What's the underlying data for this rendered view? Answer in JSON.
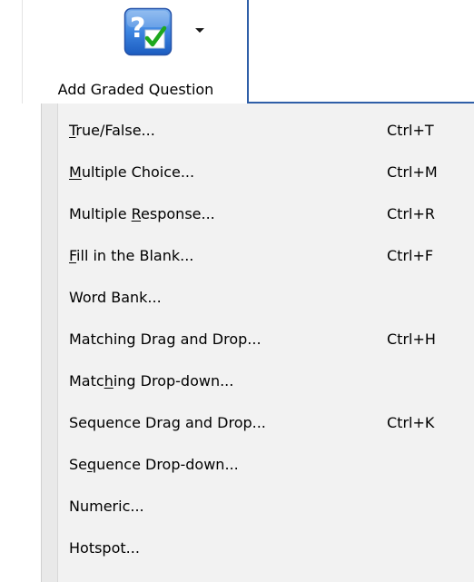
{
  "ribbon": {
    "button_label": "Add Graded Question",
    "icon": "question-checkmark-icon",
    "arrow_icon": "dropdown-arrow-icon",
    "accent_color": "#2f5fa8"
  },
  "menu": {
    "items": [
      {
        "pre": "",
        "mn": "T",
        "post": "rue/False...",
        "shortcut": "Ctrl+T"
      },
      {
        "pre": "",
        "mn": "M",
        "post": "ultiple Choice...",
        "shortcut": "Ctrl+M"
      },
      {
        "pre": "Multiple ",
        "mn": "R",
        "post": "esponse...",
        "shortcut": "Ctrl+R"
      },
      {
        "pre": "",
        "mn": "F",
        "post": "ill in the Blank...",
        "shortcut": "Ctrl+F"
      },
      {
        "pre": "Word Bank...",
        "mn": "",
        "post": "",
        "shortcut": ""
      },
      {
        "pre": "Matching Drag and Drop...",
        "mn": "",
        "post": "",
        "shortcut": "Ctrl+H"
      },
      {
        "pre": "Matc",
        "mn": "h",
        "post": "ing Drop-down...",
        "shortcut": ""
      },
      {
        "pre": "Sequence Drag and Drop...",
        "mn": "",
        "post": "",
        "shortcut": "Ctrl+K"
      },
      {
        "pre": "Se",
        "mn": "q",
        "post": "uence Drop-down...",
        "shortcut": ""
      },
      {
        "pre": "Numeric...",
        "mn": "",
        "post": "",
        "shortcut": ""
      },
      {
        "pre": "Hotspot...",
        "mn": "",
        "post": "",
        "shortcut": ""
      }
    ]
  }
}
